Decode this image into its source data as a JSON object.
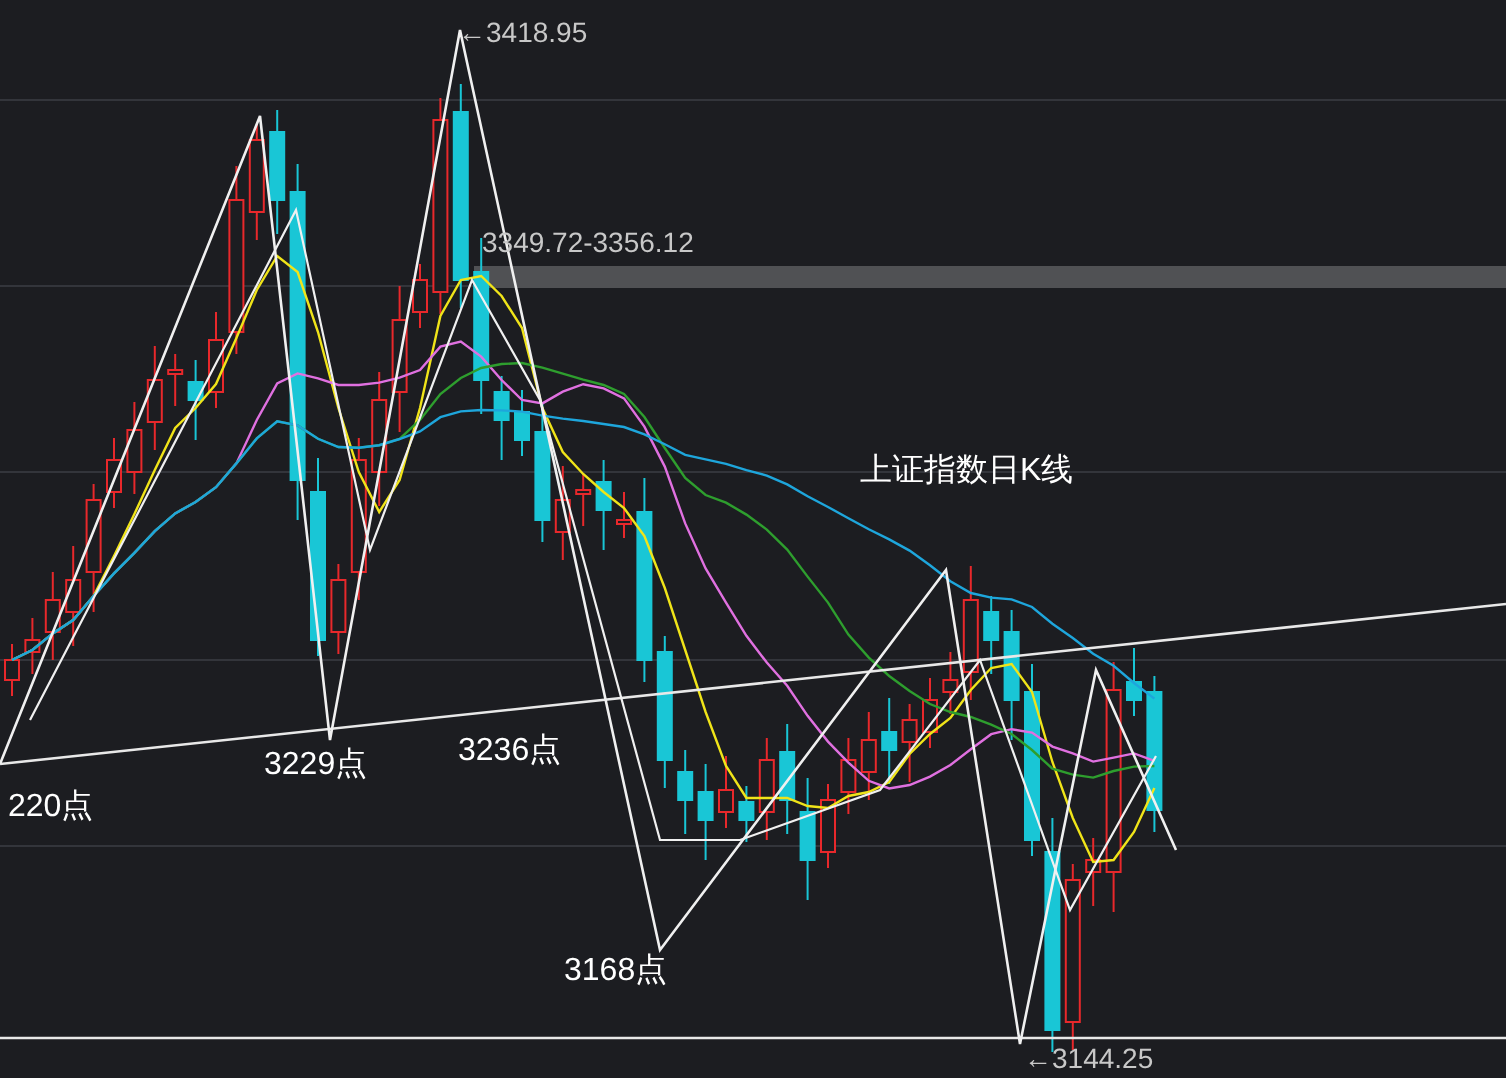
{
  "chart": {
    "title": "上证指数日K线",
    "high_label": "←3418.95",
    "zone_label": "3349.72-3356.12",
    "low_label": "←3144.25",
    "point_labels": [
      "220点",
      "3229点",
      "3236点",
      "3168点"
    ]
  }
}
